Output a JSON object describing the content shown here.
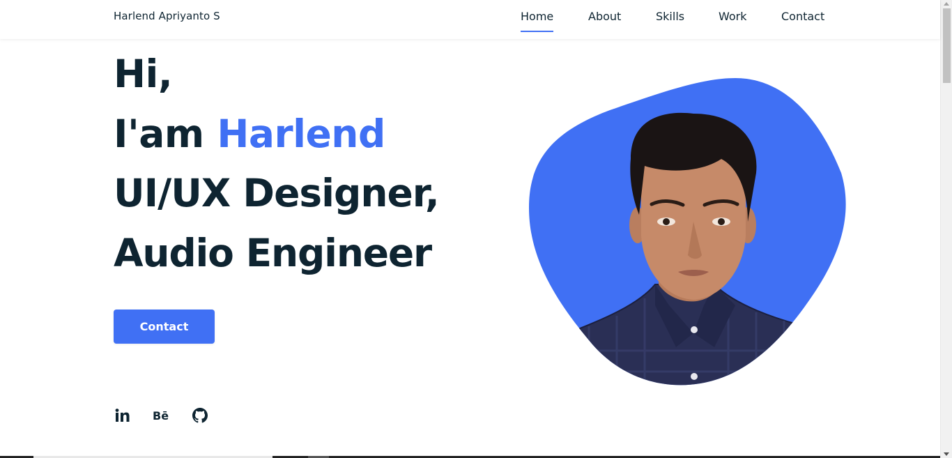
{
  "brand": "Harlend Apriyanto S",
  "nav": {
    "home": "Home",
    "about": "About",
    "skills": "Skills",
    "work": "Work",
    "contact": "Contact"
  },
  "hero": {
    "line1": "Hi,",
    "line2_prefix": "I'am ",
    "line2_name": "Harlend",
    "line3": "UI/UX Designer,",
    "line4": "Audio Engineer",
    "button": "Contact"
  },
  "social": {
    "behance": "Bē"
  },
  "icons": [
    "linkedin-icon",
    "behance-icon",
    "github-icon"
  ],
  "colors": {
    "accent": "#4070f4",
    "text": "#0e2431",
    "background": "#ffffff"
  }
}
